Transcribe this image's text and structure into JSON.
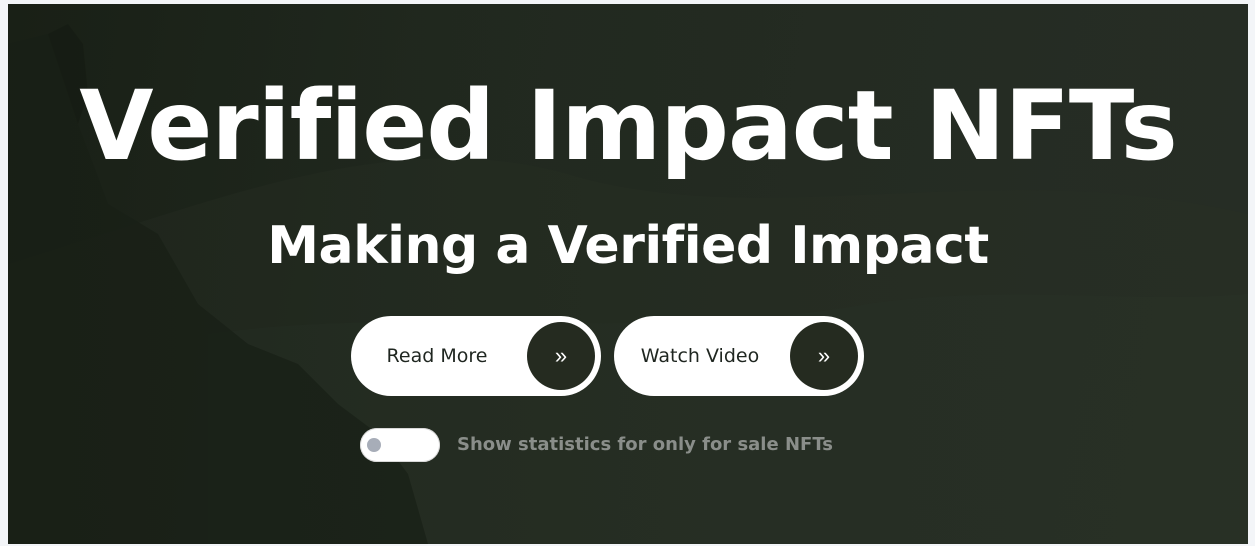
{
  "hero": {
    "title": "Verified Impact NFTs",
    "subtitle": "Making a Verified Impact"
  },
  "buttons": {
    "read_more": {
      "label": "Read More",
      "icon": "double-chevron-right-icon",
      "icon_glyph": "»"
    },
    "watch_video": {
      "label": "Watch Video",
      "icon": "double-chevron-right-icon",
      "icon_glyph": "»"
    }
  },
  "filter": {
    "toggle_label": "Show statistics for only for sale NFTs",
    "toggle_on": false
  },
  "colors": {
    "hero_background": "#222a20",
    "button_background": "#ffffff",
    "button_icon_circle": "#252b20",
    "title_text": "#ffffff",
    "toggle_label_text": "#8a8e8a"
  }
}
